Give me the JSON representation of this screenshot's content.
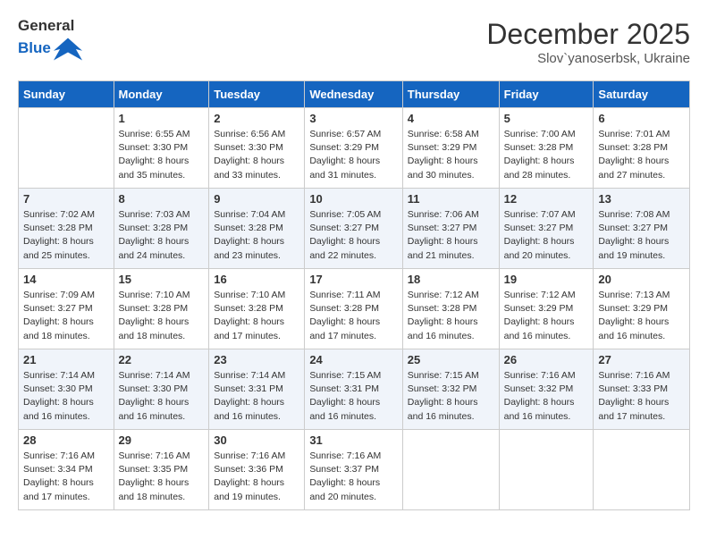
{
  "header": {
    "logo_general": "General",
    "logo_blue": "Blue",
    "month_title": "December 2025",
    "subtitle": "Slov`yanoserbsk, Ukraine"
  },
  "weekdays": [
    "Sunday",
    "Monday",
    "Tuesday",
    "Wednesday",
    "Thursday",
    "Friday",
    "Saturday"
  ],
  "weeks": [
    [
      {
        "day": "",
        "info": ""
      },
      {
        "day": "1",
        "info": "Sunrise: 6:55 AM\nSunset: 3:30 PM\nDaylight: 8 hours\nand 35 minutes."
      },
      {
        "day": "2",
        "info": "Sunrise: 6:56 AM\nSunset: 3:30 PM\nDaylight: 8 hours\nand 33 minutes."
      },
      {
        "day": "3",
        "info": "Sunrise: 6:57 AM\nSunset: 3:29 PM\nDaylight: 8 hours\nand 31 minutes."
      },
      {
        "day": "4",
        "info": "Sunrise: 6:58 AM\nSunset: 3:29 PM\nDaylight: 8 hours\nand 30 minutes."
      },
      {
        "day": "5",
        "info": "Sunrise: 7:00 AM\nSunset: 3:28 PM\nDaylight: 8 hours\nand 28 minutes."
      },
      {
        "day": "6",
        "info": "Sunrise: 7:01 AM\nSunset: 3:28 PM\nDaylight: 8 hours\nand 27 minutes."
      }
    ],
    [
      {
        "day": "7",
        "info": "Sunrise: 7:02 AM\nSunset: 3:28 PM\nDaylight: 8 hours\nand 25 minutes."
      },
      {
        "day": "8",
        "info": "Sunrise: 7:03 AM\nSunset: 3:28 PM\nDaylight: 8 hours\nand 24 minutes."
      },
      {
        "day": "9",
        "info": "Sunrise: 7:04 AM\nSunset: 3:28 PM\nDaylight: 8 hours\nand 23 minutes."
      },
      {
        "day": "10",
        "info": "Sunrise: 7:05 AM\nSunset: 3:27 PM\nDaylight: 8 hours\nand 22 minutes."
      },
      {
        "day": "11",
        "info": "Sunrise: 7:06 AM\nSunset: 3:27 PM\nDaylight: 8 hours\nand 21 minutes."
      },
      {
        "day": "12",
        "info": "Sunrise: 7:07 AM\nSunset: 3:27 PM\nDaylight: 8 hours\nand 20 minutes."
      },
      {
        "day": "13",
        "info": "Sunrise: 7:08 AM\nSunset: 3:27 PM\nDaylight: 8 hours\nand 19 minutes."
      }
    ],
    [
      {
        "day": "14",
        "info": "Sunrise: 7:09 AM\nSunset: 3:27 PM\nDaylight: 8 hours\nand 18 minutes."
      },
      {
        "day": "15",
        "info": "Sunrise: 7:10 AM\nSunset: 3:28 PM\nDaylight: 8 hours\nand 18 minutes."
      },
      {
        "day": "16",
        "info": "Sunrise: 7:10 AM\nSunset: 3:28 PM\nDaylight: 8 hours\nand 17 minutes."
      },
      {
        "day": "17",
        "info": "Sunrise: 7:11 AM\nSunset: 3:28 PM\nDaylight: 8 hours\nand 17 minutes."
      },
      {
        "day": "18",
        "info": "Sunrise: 7:12 AM\nSunset: 3:28 PM\nDaylight: 8 hours\nand 16 minutes."
      },
      {
        "day": "19",
        "info": "Sunrise: 7:12 AM\nSunset: 3:29 PM\nDaylight: 8 hours\nand 16 minutes."
      },
      {
        "day": "20",
        "info": "Sunrise: 7:13 AM\nSunset: 3:29 PM\nDaylight: 8 hours\nand 16 minutes."
      }
    ],
    [
      {
        "day": "21",
        "info": "Sunrise: 7:14 AM\nSunset: 3:30 PM\nDaylight: 8 hours\nand 16 minutes."
      },
      {
        "day": "22",
        "info": "Sunrise: 7:14 AM\nSunset: 3:30 PM\nDaylight: 8 hours\nand 16 minutes."
      },
      {
        "day": "23",
        "info": "Sunrise: 7:14 AM\nSunset: 3:31 PM\nDaylight: 8 hours\nand 16 minutes."
      },
      {
        "day": "24",
        "info": "Sunrise: 7:15 AM\nSunset: 3:31 PM\nDaylight: 8 hours\nand 16 minutes."
      },
      {
        "day": "25",
        "info": "Sunrise: 7:15 AM\nSunset: 3:32 PM\nDaylight: 8 hours\nand 16 minutes."
      },
      {
        "day": "26",
        "info": "Sunrise: 7:16 AM\nSunset: 3:32 PM\nDaylight: 8 hours\nand 16 minutes."
      },
      {
        "day": "27",
        "info": "Sunrise: 7:16 AM\nSunset: 3:33 PM\nDaylight: 8 hours\nand 17 minutes."
      }
    ],
    [
      {
        "day": "28",
        "info": "Sunrise: 7:16 AM\nSunset: 3:34 PM\nDaylight: 8 hours\nand 17 minutes."
      },
      {
        "day": "29",
        "info": "Sunrise: 7:16 AM\nSunset: 3:35 PM\nDaylight: 8 hours\nand 18 minutes."
      },
      {
        "day": "30",
        "info": "Sunrise: 7:16 AM\nSunset: 3:36 PM\nDaylight: 8 hours\nand 19 minutes."
      },
      {
        "day": "31",
        "info": "Sunrise: 7:16 AM\nSunset: 3:37 PM\nDaylight: 8 hours\nand 20 minutes."
      },
      {
        "day": "",
        "info": ""
      },
      {
        "day": "",
        "info": ""
      },
      {
        "day": "",
        "info": ""
      }
    ]
  ]
}
